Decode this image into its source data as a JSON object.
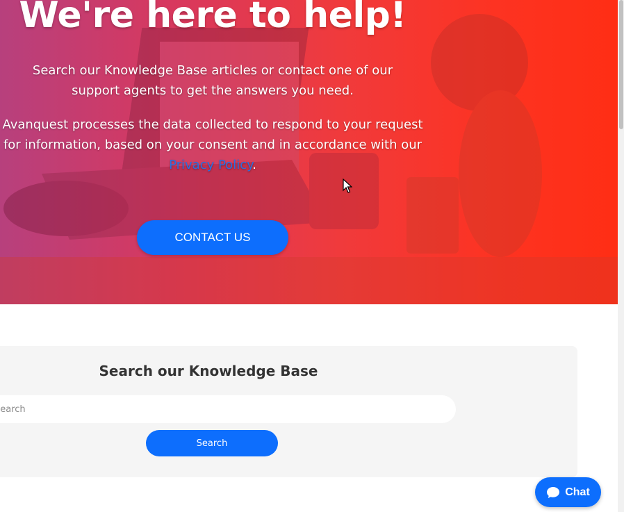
{
  "hero": {
    "title": "We're here to help!",
    "subtitle": "Search our Knowledge Base articles or contact one of our support agents to get the answers you need.",
    "consent_text": "Avanquest processes the data collected to respond to your request for information, based on your consent and in accordance with our",
    "privacy_link": "Privacy Policy",
    "consent_end": ".",
    "contact_button": "CONTACT US"
  },
  "knowledge_base": {
    "title": "Search our Knowledge Base",
    "search_placeholder": "Search",
    "search_button": "Search"
  },
  "chat": {
    "label": "Chat",
    "icon": "chat-bubble-icon"
  },
  "colors": {
    "accent": "#0d6efd",
    "hero_gradient_start": "#b7407d",
    "hero_gradient_end": "#ff2e14",
    "card_background": "#f5f5f5"
  }
}
